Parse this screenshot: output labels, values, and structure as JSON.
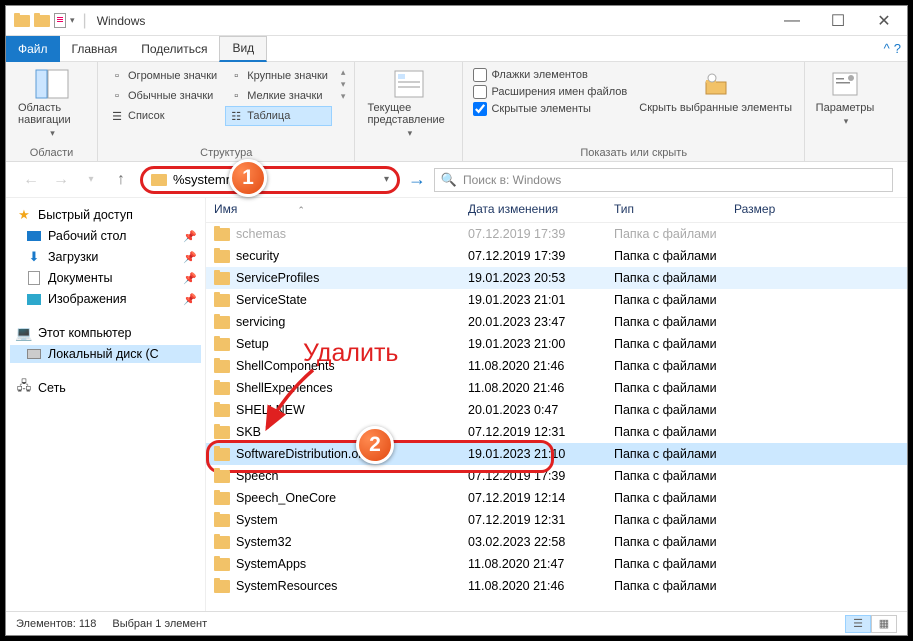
{
  "window": {
    "title": "Windows"
  },
  "menubar": {
    "file": "Файл",
    "home": "Главная",
    "share": "Поделиться",
    "view": "Вид"
  },
  "ribbon": {
    "nav_group": "Области",
    "nav_btn": "Область навигации",
    "layout_group": "Структура",
    "layout": {
      "huge": "Огромные значки",
      "large": "Крупные значки",
      "medium": "Обычные значки",
      "small": "Мелкие значки",
      "list": "Список",
      "details": "Таблица"
    },
    "current_group": "Текущее представление",
    "current_btn": "Текущее представление",
    "show_group": "Показать или скрыть",
    "checks": {
      "item_chk": "Флажки элементов",
      "ext": "Расширения имен файлов",
      "hidden": "Скрытые элементы"
    },
    "hide_btn": "Скрыть выбранные элементы",
    "options": "Параметры"
  },
  "address": {
    "value": "%systemroot%"
  },
  "search": {
    "placeholder": "Поиск в: Windows"
  },
  "sidebar": {
    "quick": "Быстрый доступ",
    "desktop": "Рабочий стол",
    "downloads": "Загрузки",
    "documents": "Документы",
    "pictures": "Изображения",
    "thispc": "Этот компьютер",
    "disk": "Локальный диск (C",
    "network": "Сеть"
  },
  "columns": {
    "name": "Имя",
    "date": "Дата изменения",
    "type": "Тип",
    "size": "Размер"
  },
  "type_folder": "Папка с файлами",
  "files": [
    {
      "name": "schemas",
      "date": "07.12.2019 17:39",
      "faded": true
    },
    {
      "name": "security",
      "date": "07.12.2019 17:39"
    },
    {
      "name": "ServiceProfiles",
      "date": "19.01.2023 20:53",
      "hover": true
    },
    {
      "name": "ServiceState",
      "date": "19.01.2023 21:01"
    },
    {
      "name": "servicing",
      "date": "20.01.2023 23:47"
    },
    {
      "name": "Setup",
      "date": "19.01.2023 21:00"
    },
    {
      "name": "ShellComponents",
      "date": "11.08.2020 21:46"
    },
    {
      "name": "ShellExperiences",
      "date": "11.08.2020 21:46"
    },
    {
      "name": "SHELLNEW",
      "date": "20.01.2023 0:47"
    },
    {
      "name": "SKB",
      "date": "07.12.2019 12:31"
    },
    {
      "name": "SoftwareDistribution.old",
      "date": "19.01.2023 21:10",
      "sel": true,
      "target": true
    },
    {
      "name": "Speech",
      "date": "07.12.2019 17:39"
    },
    {
      "name": "Speech_OneCore",
      "date": "07.12.2019 12:14"
    },
    {
      "name": "System",
      "date": "07.12.2019 12:31"
    },
    {
      "name": "System32",
      "date": "03.02.2023 22:58"
    },
    {
      "name": "SystemApps",
      "date": "11.08.2020 21:47"
    },
    {
      "name": "SystemResources",
      "date": "11.08.2020 21:46"
    }
  ],
  "status": {
    "count": "Элементов: 118",
    "selected": "Выбран 1 элемент"
  },
  "annotation": {
    "delete": "Удалить",
    "step1": "1",
    "step2": "2"
  }
}
